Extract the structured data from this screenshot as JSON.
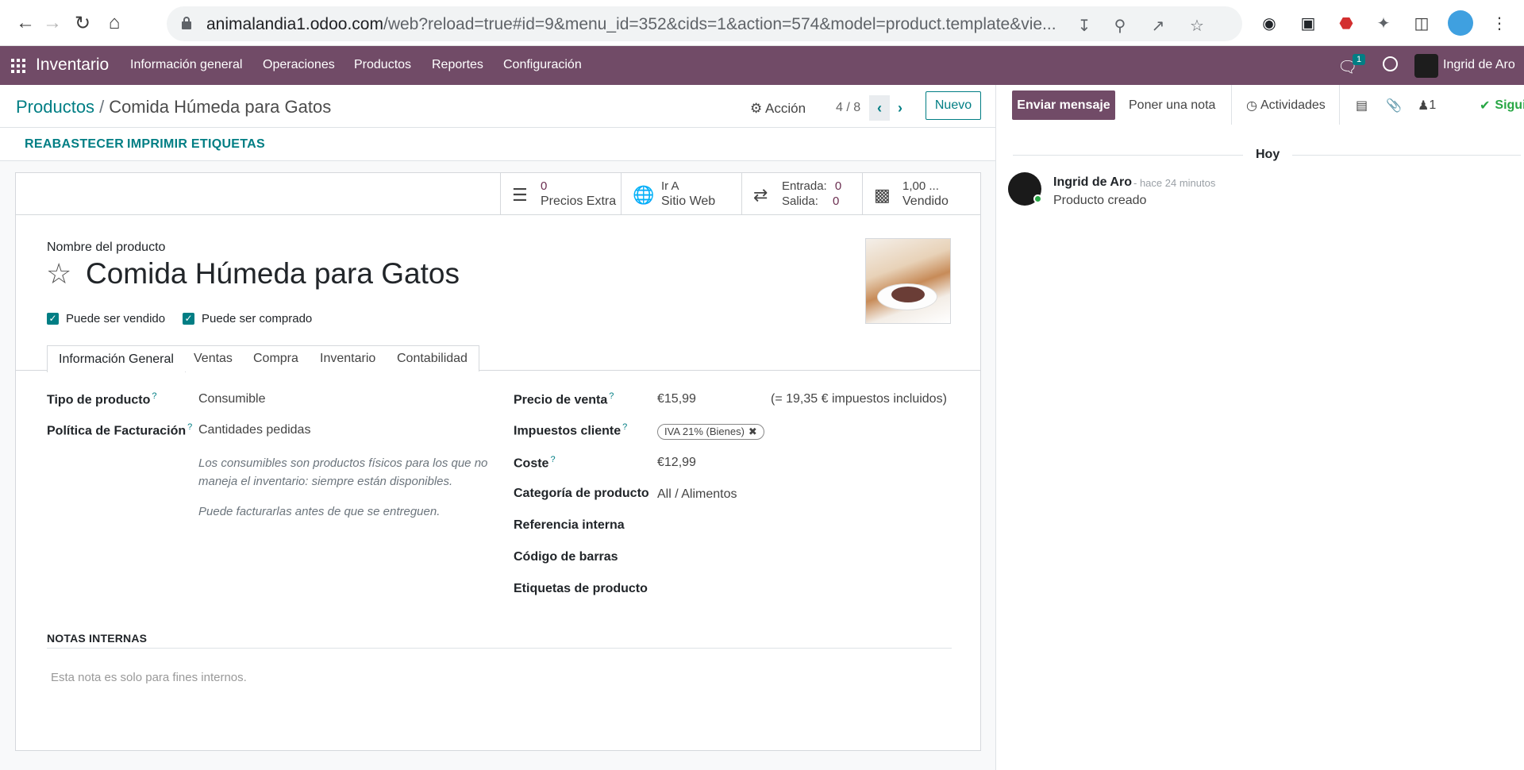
{
  "browser": {
    "url_host": "animalandia1.odoo.com",
    "url_rest": "/web?reload=true#id=9&menu_id=352&cids=1&action=574&model=product.template&vie..."
  },
  "navbar": {
    "app_name": "Inventario",
    "menus": [
      "Información general",
      "Operaciones",
      "Productos",
      "Reportes",
      "Configuración"
    ],
    "message_count": "1",
    "user": "Ingrid de Aro"
  },
  "control_panel": {
    "breadcrumb_parent": "Productos",
    "breadcrumb_sep": "/",
    "breadcrumb_current": "Comida Húmeda para Gatos",
    "action_label": "Acción",
    "pager": "4 / 8",
    "new_label": "Nuevo",
    "header_buttons": [
      "REABASTECER",
      "IMPRIMIR ETIQUETAS"
    ]
  },
  "stat_buttons": {
    "extra_prices": {
      "value": "0",
      "label": "Precios Extra"
    },
    "website": {
      "line1": "Ir A",
      "line2": "Sitio Web"
    },
    "moves": {
      "in_label": "Entrada:",
      "in_value": "0",
      "out_label": "Salida:",
      "out_value": "0"
    },
    "sold": {
      "value": "1,00 ...",
      "label": "Vendido"
    }
  },
  "product": {
    "name_label": "Nombre del producto",
    "name": "Comida Húmeda para Gatos",
    "can_be_sold": "Puede ser vendido",
    "can_be_purchased": "Puede ser comprado"
  },
  "tabs": [
    "Información General",
    "Ventas",
    "Compra",
    "Inventario",
    "Contabilidad"
  ],
  "general_info": {
    "product_type_label": "Tipo de producto",
    "product_type": "Consumible",
    "invoice_policy_label": "Política de Facturación",
    "invoice_policy": "Cantidades pedidas",
    "help1": "Los consumibles son productos físicos para los que no maneja el inventario: siempre están disponibles.",
    "help2": "Puede facturarlas antes de que se entreguen.",
    "sale_price_label": "Precio de venta",
    "sale_price": "€15,99",
    "sale_price_tax": "(= 19,35 € impuestos incluidos)",
    "customer_tax_label": "Impuestos cliente",
    "customer_tax": "IVA 21% (Bienes)",
    "cost_label": "Coste",
    "cost": "€12,99",
    "category_label": "Categoría de producto",
    "category": "All / Alimentos",
    "internal_ref_label": "Referencia interna",
    "barcode_label": "Código de barras",
    "tags_label": "Etiquetas de producto",
    "help_mark": "?"
  },
  "notes": {
    "title": "NOTAS INTERNAS",
    "placeholder": "Esta nota es solo para fines internos."
  },
  "chatter": {
    "send_message": "Enviar mensaje",
    "log_note": "Poner una nota",
    "activities": "Actividades",
    "followers_count": "1",
    "follow": "Siguie",
    "date_sep": "Hoy",
    "author": "Ingrid de Aro",
    "time": "- hace 24 minutos",
    "body": "Producto creado"
  },
  "colors": {
    "brand": "#714b67",
    "accent": "#017e84"
  }
}
